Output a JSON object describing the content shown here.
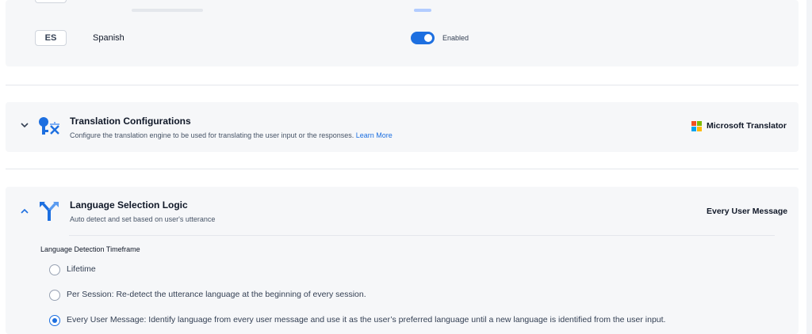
{
  "languages": {
    "row": {
      "code": "ES",
      "name": "Spanish",
      "status": "Enabled",
      "enabled": true
    }
  },
  "translation": {
    "title": "Translation Configurations",
    "description": "Configure the translation engine to be used for translating the user input or the responses.",
    "learn_more": "Learn More",
    "engine": "Microsoft Translator",
    "icon": "translate-icon",
    "chevron": "chevron-down-icon"
  },
  "selection_logic": {
    "title": "Language Selection Logic",
    "description": "Auto detect and set based on user's utterance",
    "current": "Every User Message",
    "icon": "merge-arrows-icon",
    "chevron": "chevron-up-icon",
    "timeframe_label": "Language Detection Timeframe",
    "options": [
      {
        "label": "Lifetime",
        "selected": false
      },
      {
        "label": "Per Session: Re-detect the utterance language at the beginning of every session.",
        "selected": false
      },
      {
        "label": "Every User Message: Identify language from every user message and use it as the user’s preferred language until a new language is identified from the user input.",
        "selected": true
      }
    ]
  },
  "colors": {
    "accent": "#1d6fe0",
    "panel_bg": "#f6f7f9",
    "ms_red": "#f25022",
    "ms_green": "#7fba00",
    "ms_blue": "#00a4ef",
    "ms_yellow": "#ffb900"
  }
}
